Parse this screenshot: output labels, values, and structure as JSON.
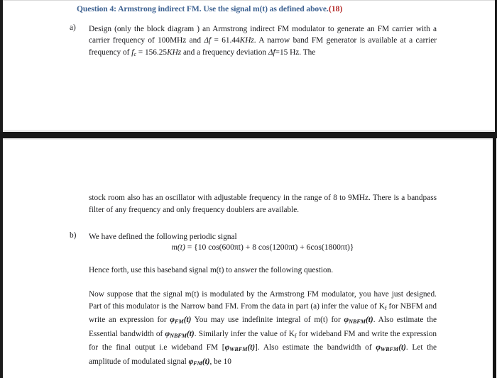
{
  "document": {
    "type": "scanned-exam-question",
    "colors": {
      "heading": "#3f6392",
      "marks": "#b42a28",
      "body_text": "#16161a",
      "scan_band": "#161616",
      "page_background": "#ffffff"
    }
  },
  "question": {
    "heading": "Question 4: Armstrong indirect FM. Use the signal m(t) as defined above.",
    "marks": "(18)"
  },
  "parts": {
    "a": {
      "label": "a)",
      "text_line1": "Design (only the block diagram ) an Armstrong indirect FM modulator to generate an FM carrier",
      "text_line2_pre": "with a carrier frequency of 100MHz and ",
      "delta_f_1": "Δf",
      "text_line2_mid": " = 61.44",
      "khz_1": "KHz",
      "text_line2_post": ". A narrow band FM generator is",
      "text_line3_pre": "available at a carrier frequency of ",
      "fc": "f",
      "fc_sub": "c",
      "text_line3_mid": " = 156.25",
      "khz_2": "KHz",
      "text_line3_mid2": " and a frequency deviation ",
      "delta_f_2": "Δf",
      "text_line3_post": "=15 Hz. The",
      "continuation": "stock room also has an oscillator with adjustable frequency in the range of 8 to 9MHz. There is a bandpass filter of any frequency and only frequency doublers are available."
    },
    "b": {
      "label": "b)",
      "intro": "We have defined the following periodic signal",
      "equation": {
        "lhs": "m(t)",
        "eq": " = ",
        "rhs": "{10 cos(600πt) + 8 cos(1200πt) + 6cos(1800πt)}"
      },
      "hence_forth": "Hence forth, use this baseband signal m(t) to answer the following question.",
      "now_suppose_1": "Now suppose that the signal m(t) is modulated by the Armstrong FM modulator, you have just designed. Part of this modulator is the Narrow band FM. From the data in part (a) infer the value of K",
      "k_sub_f": "f",
      "now_suppose_2": " for NBFM and write an expression for ",
      "phi_fm": "φ",
      "phi_fm_sub": "FM",
      "phi_fm_arg": "(t)",
      "now_suppose_3": " You may use indefinite integral of m(t) for ",
      "phi_nbfm": "φ",
      "phi_nbfm_sub": "NBFM",
      "phi_nbfm_arg": "(t)",
      "now_suppose_4": ". Also estimate the Essential bandwidth of ",
      "phi_nbfm_2": "φ",
      "phi_nbfm_2_sub": "NBFM",
      "phi_nbfm_2_arg": "(t)",
      "now_suppose_5": ". Similarly infer the value of K",
      "k_sub_f_2": "f",
      "now_suppose_6": " for wideband FM and write the expression for the final output i.e wideband FM [",
      "phi_wbfm": "φ",
      "phi_wbfm_sub": "WBFM",
      "phi_wbfm_arg": "(t)",
      "now_suppose_7": "]. Also estimate the bandwidth of  ",
      "phi_wbfm_2": "φ",
      "phi_wbfm_2_sub": "WBFM",
      "phi_wbfm_2_arg": "(t)",
      "now_suppose_8": ". Let the amplitude of modulated signal ",
      "phi_fm_2": "φ",
      "phi_fm_2_sub": "FM",
      "phi_fm_2_arg": "(t)",
      "now_suppose_9": ", be 10"
    }
  }
}
